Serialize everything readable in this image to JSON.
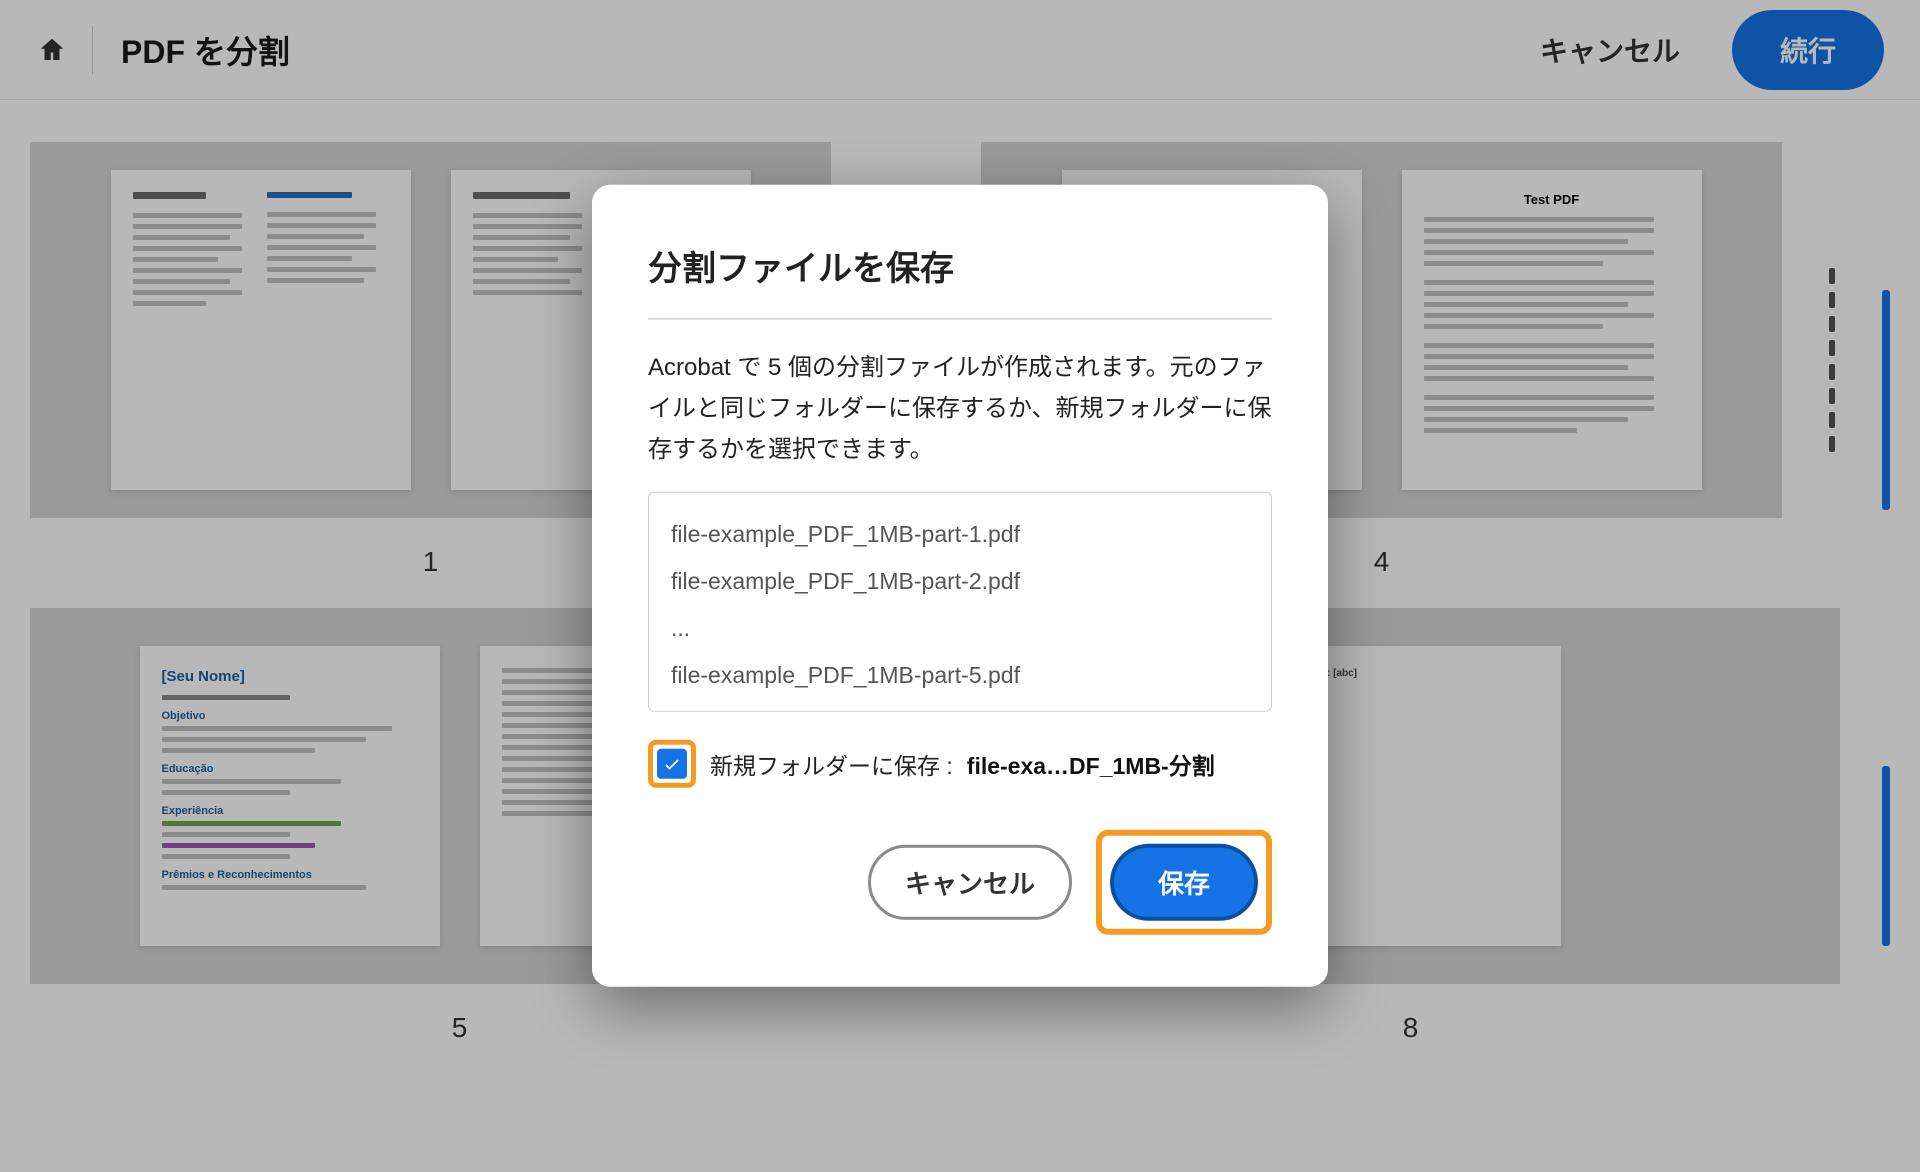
{
  "header": {
    "title": "PDF を分割",
    "cancel": "キャンセル",
    "continue": "続行"
  },
  "pages": {
    "row1": [
      "1",
      "4"
    ],
    "row2": [
      "5",
      "8"
    ]
  },
  "modal": {
    "title": "分割ファイルを保存",
    "description": "Acrobat で 5 個の分割ファイルが作成されます。元のファイルと同じフォルダーに保存するか、新規フォルダーに保存するかを選択できます。",
    "files": [
      "file-example_PDF_1MB-part-1.pdf",
      "file-example_PDF_1MB-part-2.pdf",
      "...",
      "file-example_PDF_1MB-part-5.pdf"
    ],
    "checkbox_label": "新規フォルダーに保存 : ",
    "folder_name": "file-exa…DF_1MB-分割",
    "cancel": "キャンセル",
    "save": "保存"
  },
  "doc_sample": {
    "seu_nome": "[Seu Nome]",
    "objetivo": "Objetivo",
    "educacao": "Educação",
    "experiencia": "Experiência",
    "premios": "Prêmios e Reconhecimentos",
    "test_pdf": "Test PDF",
    "filename_label": "FileName: [abc]"
  }
}
